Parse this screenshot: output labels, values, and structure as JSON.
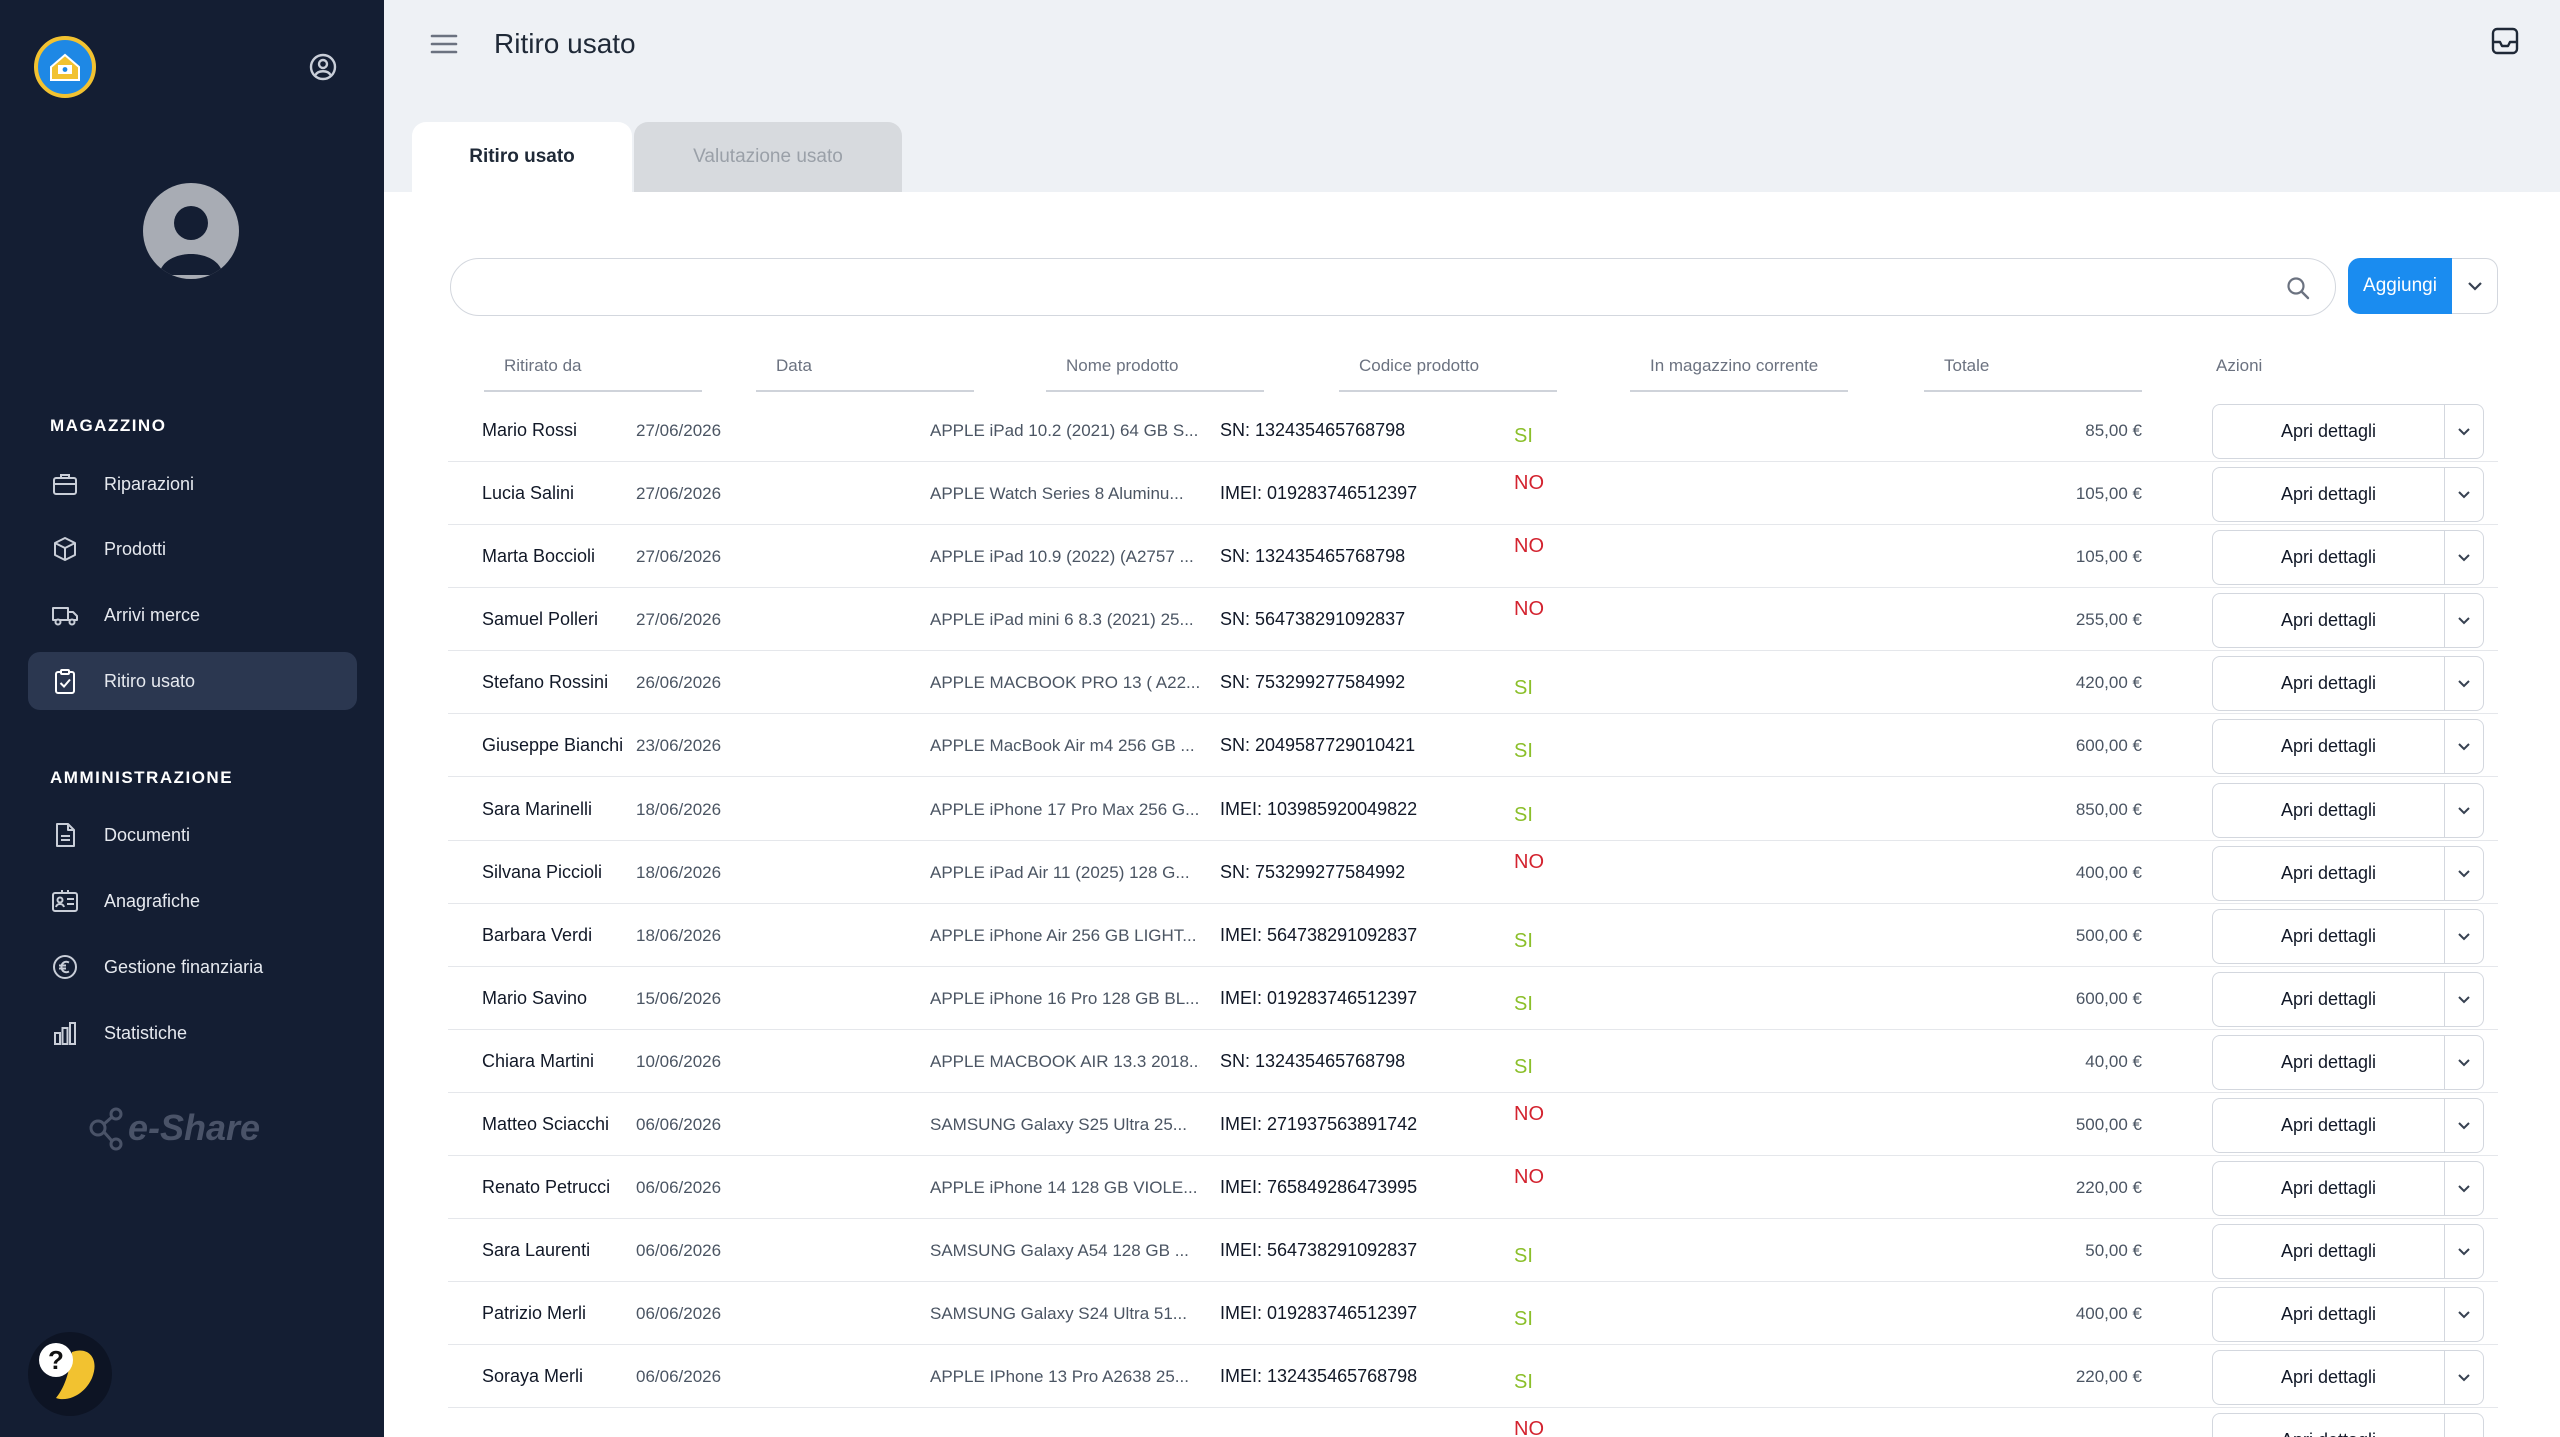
{
  "sidebar": {
    "sections": [
      {
        "title": "MAGAZZINO",
        "items": [
          {
            "label": "Riparazioni",
            "icon": "briefcase-icon"
          },
          {
            "label": "Prodotti",
            "icon": "box-icon"
          },
          {
            "label": "Arrivi merce",
            "icon": "truck-icon"
          },
          {
            "label": "Ritiro usato",
            "icon": "clipboard-icon",
            "active": true
          }
        ]
      },
      {
        "title": "AMMINISTRAZIONE",
        "items": [
          {
            "label": "Documenti",
            "icon": "document-icon"
          },
          {
            "label": "Anagrafiche",
            "icon": "id-card-icon"
          },
          {
            "label": "Gestione finanziaria",
            "icon": "euro-icon"
          },
          {
            "label": "Statistiche",
            "icon": "bar-chart-icon"
          }
        ]
      }
    ],
    "brand": "e-Share"
  },
  "header": {
    "title": "Ritiro usato"
  },
  "tabs": [
    {
      "label": "Ritiro usato",
      "active": true
    },
    {
      "label": "Valutazione usato",
      "active": false
    }
  ],
  "search": {
    "placeholder": ""
  },
  "add_button": {
    "label": "Aggiungi"
  },
  "table": {
    "columns": [
      "Ritirato da",
      "Data",
      "Nome prodotto",
      "Codice prodotto",
      "In magazzino corrente",
      "Totale",
      "Azioni"
    ],
    "action_label": "Apri dettagli",
    "rows": [
      {
        "name": "Mario Rossi",
        "date": "27/06/2026",
        "product": "APPLE iPad 10.2 (2021) 64 GB S...",
        "code": "SN: 132435465768798",
        "stock": "SI",
        "total": "85,00 €"
      },
      {
        "name": "Lucia Salini",
        "date": "27/06/2026",
        "product": "APPLE Watch Series 8 Aluminu...",
        "code": "IMEI: 019283746512397",
        "stock": "NO",
        "total": "105,00 €"
      },
      {
        "name": "Marta Boccioli",
        "date": "27/06/2026",
        "product": "APPLE iPad 10.9 (2022) (A2757 ...",
        "code": "SN: 132435465768798",
        "stock": "NO",
        "total": "105,00 €"
      },
      {
        "name": "Samuel Polleri",
        "date": "27/06/2026",
        "product": "APPLE iPad mini 6 8.3 (2021) 25...",
        "code": "SN: 564738291092837",
        "stock": "NO",
        "total": "255,00 €"
      },
      {
        "name": "Stefano Rossini",
        "date": "26/06/2026",
        "product": "APPLE MACBOOK PRO 13 ( A22...",
        "code": "SN: 753299277584992",
        "stock": "SI",
        "total": "420,00 €"
      },
      {
        "name": "Giuseppe Bianchi",
        "date": "23/06/2026",
        "product": "APPLE MacBook Air m4 256 GB ...",
        "code": "SN: 2049587729010421",
        "stock": "SI",
        "total": "600,00 €"
      },
      {
        "name": "Sara Marinelli",
        "date": "18/06/2026",
        "product": "APPLE iPhone 17 Pro Max 256 G...",
        "code": "IMEI: 103985920049822",
        "stock": "SI",
        "total": "850,00 €"
      },
      {
        "name": "Silvana Piccioli",
        "date": "18/06/2026",
        "product": "APPLE iPad Air 11 (2025) 128 G...",
        "code": "SN: 753299277584992",
        "stock": "NO",
        "total": "400,00 €"
      },
      {
        "name": "Barbara Verdi",
        "date": "18/06/2026",
        "product": "APPLE iPhone Air 256 GB LIGHT...",
        "code": "IMEI: 564738291092837",
        "stock": "SI",
        "total": "500,00 €"
      },
      {
        "name": "Mario Savino",
        "date": "15/06/2026",
        "product": "APPLE iPhone 16 Pro 128 GB BL...",
        "code": "IMEI: 019283746512397",
        "stock": "SI",
        "total": "600,00 €"
      },
      {
        "name": "Chiara Martini",
        "date": "10/06/2026",
        "product": "APPLE MACBOOK AIR 13.3 2018...",
        "code": "SN: 132435465768798",
        "stock": "SI",
        "total": "40,00 €"
      },
      {
        "name": "Matteo Sciacchi",
        "date": "06/06/2026",
        "product": "SAMSUNG Galaxy S25 Ultra 25...",
        "code": "IMEI: 271937563891742",
        "stock": "NO",
        "total": "500,00 €"
      },
      {
        "name": "Renato Petrucci",
        "date": "06/06/2026",
        "product": "APPLE iPhone 14 128 GB VIOLE...",
        "code": "IMEI: 765849286473995",
        "stock": "NO",
        "total": "220,00 €"
      },
      {
        "name": "Sara Laurenti",
        "date": "06/06/2026",
        "product": "SAMSUNG Galaxy A54 128 GB ...",
        "code": "IMEI: 564738291092837",
        "stock": "SI",
        "total": "50,00 €"
      },
      {
        "name": "Patrizio Merli",
        "date": "06/06/2026",
        "product": "SAMSUNG Galaxy S24 Ultra 51...",
        "code": "IMEI: 019283746512397",
        "stock": "SI",
        "total": "400,00 €"
      },
      {
        "name": "Soraya Merli",
        "date": "06/06/2026",
        "product": "APPLE IPhone 13 Pro A2638 25...",
        "code": "IMEI: 132435465768798",
        "stock": "SI",
        "total": "220,00 €"
      },
      {
        "name": "",
        "date": "",
        "product": "",
        "code": "",
        "stock": "NO",
        "total": ""
      }
    ]
  },
  "colors": {
    "sidebar_bg": "#141e33",
    "accent": "#1a8cf0",
    "si": "#8bbf2a",
    "no": "#d3232f"
  }
}
